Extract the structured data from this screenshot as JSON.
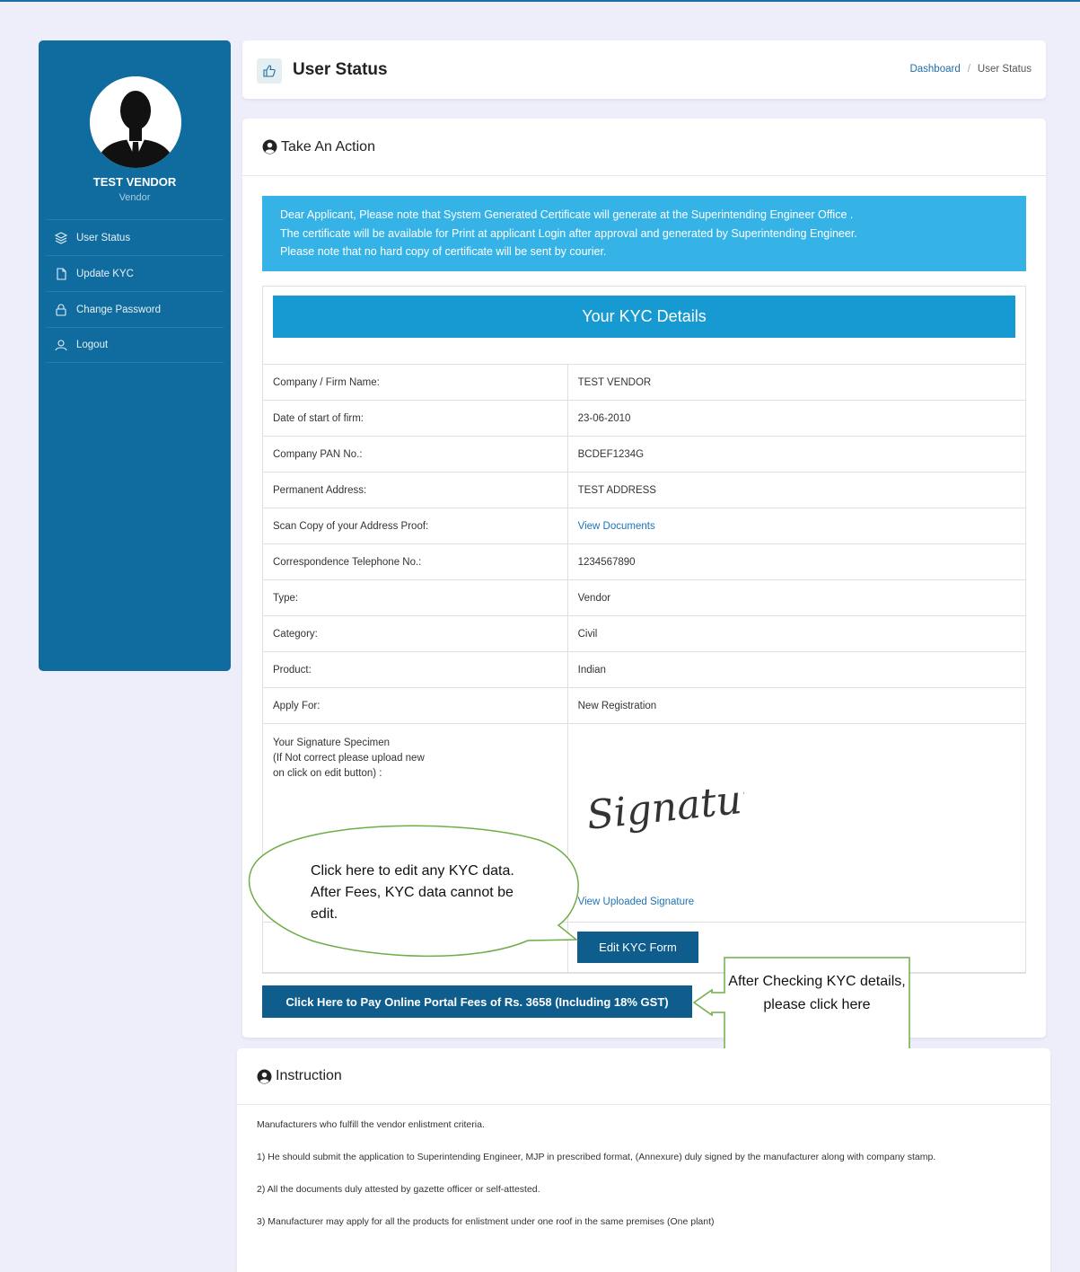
{
  "sidebar": {
    "user_name": "TEST VENDOR",
    "user_role": "Vendor",
    "items": [
      {
        "label": "User Status",
        "icon": "layers-icon"
      },
      {
        "label": "Update KYC",
        "icon": "file-icon"
      },
      {
        "label": "Change Password",
        "icon": "lock-icon"
      },
      {
        "label": "Logout",
        "icon": "user-icon"
      }
    ]
  },
  "header": {
    "title": "User Status",
    "breadcrumb": [
      "Dashboard",
      "User Status"
    ]
  },
  "action_card": {
    "title": "Take An Action",
    "notice": [
      "Dear Applicant, Please note that System Generated Certificate will generate at the Superintending Engineer Office .",
      "The certificate will be available for Print at applicant Login after approval and generated by Superintending Engineer.",
      "Please note that no hard copy of certificate will be sent by courier."
    ],
    "kyc_title": "Your KYC Details",
    "rows": [
      {
        "label": "Company / Firm Name:",
        "value": "TEST VENDOR"
      },
      {
        "label": "Date of start of firm:",
        "value": "23-06-2010"
      },
      {
        "label": "Company PAN No.:",
        "value": "BCDEF1234G"
      },
      {
        "label": "Permanent Address:",
        "value": "TEST ADDRESS"
      },
      {
        "label": "Scan Copy of your Address Proof:",
        "value": "View Documents"
      },
      {
        "label": "Correspondence Telephone No.:",
        "value": "1234567890"
      },
      {
        "label": "Type:",
        "value": "Vendor"
      },
      {
        "label": "Category:",
        "value": "Civil"
      },
      {
        "label": "Product:",
        "value": "Indian"
      },
      {
        "label": "Apply For:",
        "value": "New Registration"
      }
    ],
    "signature_label": "Your Signature Specimen\n(If Not correct please upload new\non click on edit button) :",
    "signature_image_text": "Signature",
    "signature_link": "View Uploaded Signature",
    "edit_button": "Edit KYC Form",
    "pay_button": "Click Here to Pay Online Portal Fees of Rs. 3658 (Including 18% GST)"
  },
  "callouts": {
    "edit_note": "Click here to edit any KYC data. After Fees, KYC data cannot be edit.",
    "pay_note": "After Checking KYC details, please click here",
    "color": "#70ad47"
  },
  "instruction_card": {
    "title": "Instruction",
    "items": [
      "Manufacturers who fulfill the vendor enlistment criteria.",
      "1) He should submit the application to Superintending Engineer, MJP in prescribed format, (Annexure) duly signed by the manufacturer along with company stamp.",
      "2) All the documents duly attested by gazette officer or self-attested.",
      "3) Manufacturer may apply for all the products for enlistment under one roof in the same premises (One plant)"
    ]
  },
  "colors": {
    "sidebar": "#106c9e",
    "notice": "#36b3e6",
    "kyc_banner": "#179ad2",
    "button": "#0e5d8d",
    "link": "#1d74b7"
  }
}
